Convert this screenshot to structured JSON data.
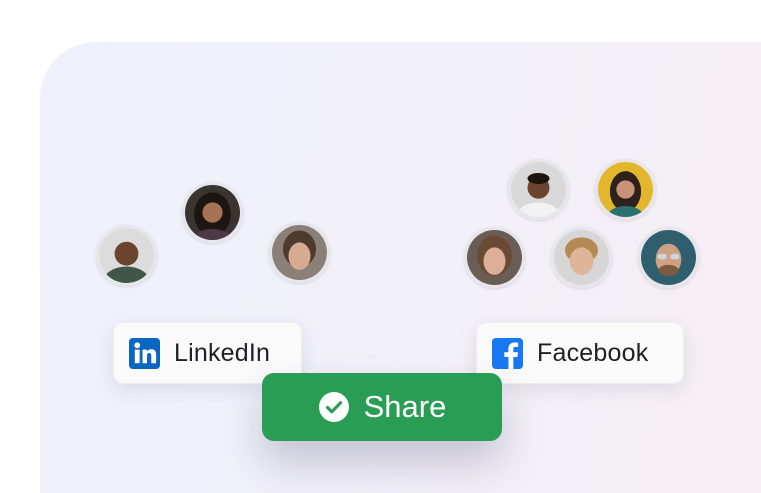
{
  "networks": [
    {
      "label": "LinkedIn",
      "icon": "linkedin-icon",
      "color": "#0a66c2"
    },
    {
      "label": "Facebook",
      "icon": "facebook-icon",
      "color": "#1877f2"
    }
  ],
  "share": {
    "label": "Share",
    "icon": "check-circle-icon",
    "color": "#2a9d55"
  },
  "avatars": {
    "linkedin_group": [
      "avatar",
      "avatar",
      "avatar"
    ],
    "facebook_group": [
      "avatar",
      "avatar",
      "avatar",
      "avatar",
      "avatar"
    ]
  }
}
